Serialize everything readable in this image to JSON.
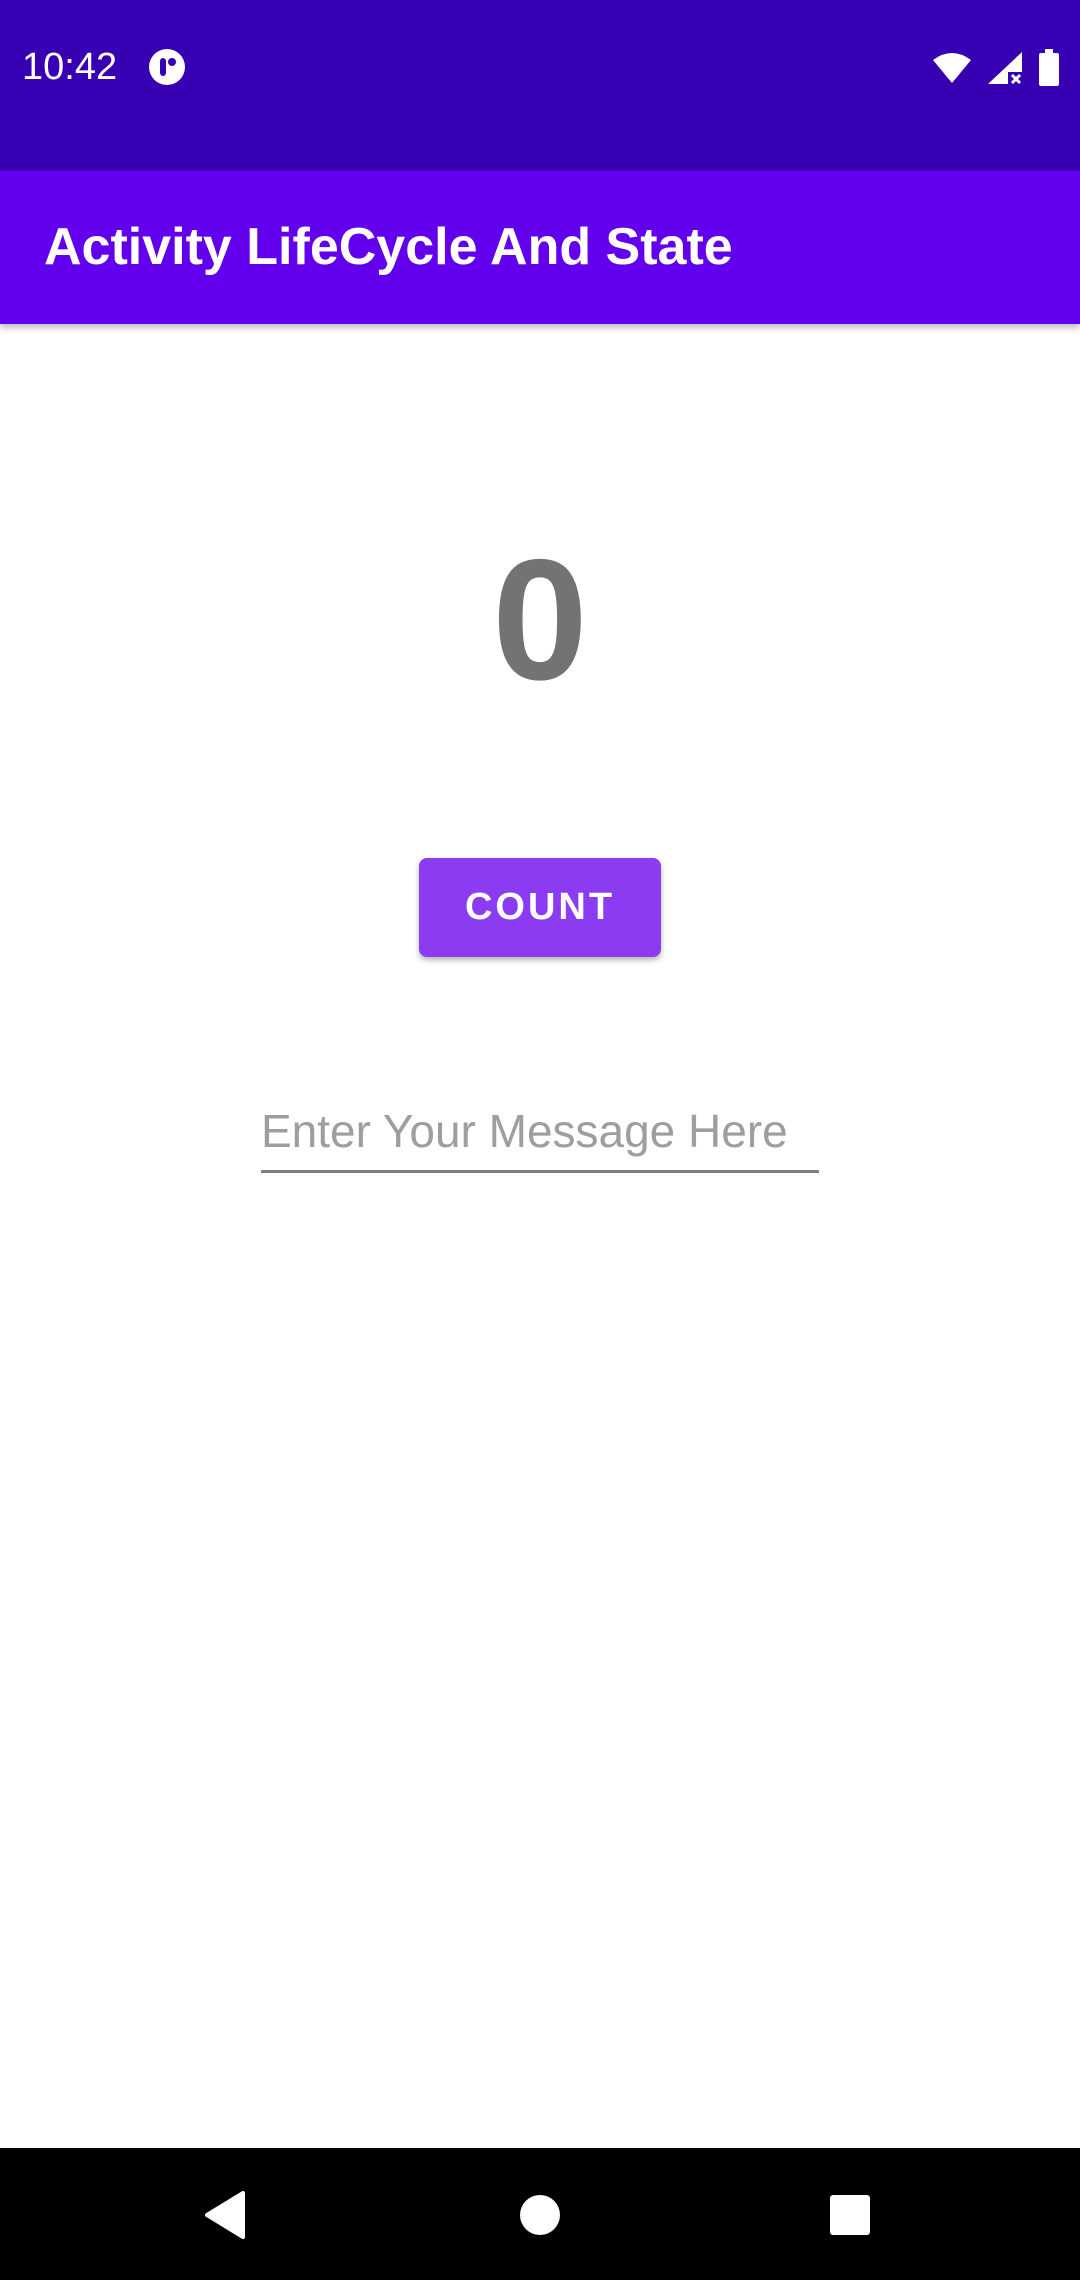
{
  "status_bar": {
    "time": "10:42",
    "icons": [
      "app-notification-icon",
      "wifi-icon",
      "cellular-signal-icon",
      "battery-icon"
    ],
    "background": "#3700B3"
  },
  "app_bar": {
    "title": "Activity LifeCycle And State",
    "background": "#6200EE"
  },
  "main": {
    "counter_value": "0",
    "count_button_label": "COUNT",
    "message_input": {
      "value": "",
      "placeholder": "Enter Your Message Here"
    },
    "accent": "#8B3CF0"
  },
  "nav_bar": {
    "buttons": [
      "back-icon",
      "home-icon",
      "recents-icon"
    ]
  }
}
